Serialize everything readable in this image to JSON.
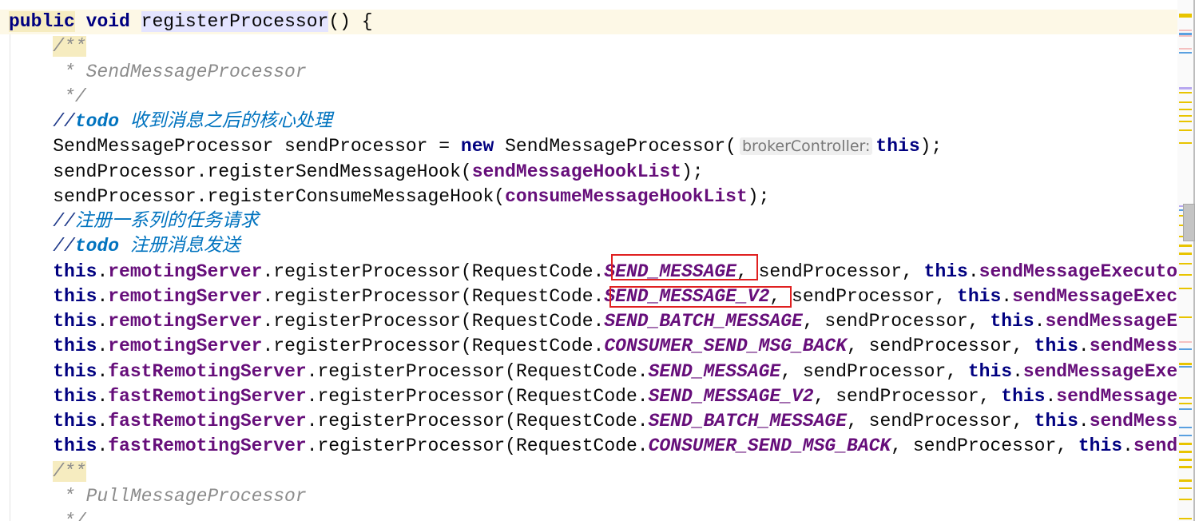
{
  "editor": {
    "lines": [
      [
        {
          "t": "public",
          "c": "kw hl-match"
        },
        {
          "t": " "
        },
        {
          "t": "void",
          "c": "kw"
        },
        {
          "t": " "
        },
        {
          "t": "registerProcessor",
          "c": "hl-ident"
        },
        {
          "t": "() {"
        }
      ],
      [
        {
          "t": "    "
        },
        {
          "t": "/**",
          "c": "doc hl-match"
        }
      ],
      [
        {
          "t": "     * SendMessageProcessor",
          "c": "doc"
        }
      ],
      [
        {
          "t": "     */",
          "c": "doc"
        }
      ],
      [
        {
          "t": "    "
        },
        {
          "t": "//",
          "c": "cmslash"
        },
        {
          "t": "todo",
          "c": "todo"
        },
        {
          "t": " 收到消息之后的核心处理",
          "c": "cm"
        }
      ],
      [
        {
          "t": "    SendMessageProcessor sendProcessor = "
        },
        {
          "t": "new",
          "c": "kw"
        },
        {
          "t": " SendMessageProcessor("
        },
        {
          "t": "brokerController:",
          "c": "hint"
        },
        {
          "t": "this",
          "c": "kw"
        },
        {
          "t": ");"
        }
      ],
      [
        {
          "t": "    sendProcessor.registerSendMessageHook("
        },
        {
          "t": "sendMessageHookList",
          "c": "fld"
        },
        {
          "t": ");"
        }
      ],
      [
        {
          "t": "    sendProcessor.registerConsumeMessageHook("
        },
        {
          "t": "consumeMessageHookList",
          "c": "fld"
        },
        {
          "t": ");"
        }
      ],
      [
        {
          "t": "    "
        },
        {
          "t": "//",
          "c": "cmslash"
        },
        {
          "t": "注册一系列的任务请求",
          "c": "cm"
        }
      ],
      [
        {
          "t": "    "
        },
        {
          "t": "//",
          "c": "cmslash"
        },
        {
          "t": "todo",
          "c": "todo"
        },
        {
          "t": " 注册消息发送",
          "c": "cm"
        }
      ],
      [
        {
          "t": "    "
        },
        {
          "t": "this",
          "c": "kw"
        },
        {
          "t": "."
        },
        {
          "t": "remotingServer",
          "c": "fld"
        },
        {
          "t": ".registerProcessor(RequestCode."
        },
        {
          "t": "SEND_MESSAGE",
          "c": "cst"
        },
        {
          "t": ", sendProcessor, "
        },
        {
          "t": "this",
          "c": "kw"
        },
        {
          "t": "."
        },
        {
          "t": "sendMessageExecuto",
          "c": "fld"
        }
      ],
      [
        {
          "t": "    "
        },
        {
          "t": "this",
          "c": "kw"
        },
        {
          "t": "."
        },
        {
          "t": "remotingServer",
          "c": "fld"
        },
        {
          "t": ".registerProcessor(RequestCode."
        },
        {
          "t": "SEND_MESSAGE_V2",
          "c": "cst"
        },
        {
          "t": ", sendProcessor, "
        },
        {
          "t": "this",
          "c": "kw"
        },
        {
          "t": "."
        },
        {
          "t": "sendMessageExec",
          "c": "fld"
        }
      ],
      [
        {
          "t": "    "
        },
        {
          "t": "this",
          "c": "kw"
        },
        {
          "t": "."
        },
        {
          "t": "remotingServer",
          "c": "fld"
        },
        {
          "t": ".registerProcessor(RequestCode."
        },
        {
          "t": "SEND_BATCH_MESSAGE",
          "c": "cst"
        },
        {
          "t": ", sendProcessor, "
        },
        {
          "t": "this",
          "c": "kw"
        },
        {
          "t": "."
        },
        {
          "t": "sendMessageE",
          "c": "fld"
        }
      ],
      [
        {
          "t": "    "
        },
        {
          "t": "this",
          "c": "kw"
        },
        {
          "t": "."
        },
        {
          "t": "remotingServer",
          "c": "fld"
        },
        {
          "t": ".registerProcessor(RequestCode."
        },
        {
          "t": "CONSUMER_SEND_MSG_BACK",
          "c": "cst"
        },
        {
          "t": ", sendProcessor, "
        },
        {
          "t": "this",
          "c": "kw"
        },
        {
          "t": "."
        },
        {
          "t": "sendMess",
          "c": "fld"
        }
      ],
      [
        {
          "t": "    "
        },
        {
          "t": "this",
          "c": "kw"
        },
        {
          "t": "."
        },
        {
          "t": "fastRemotingServer",
          "c": "fld"
        },
        {
          "t": ".registerProcessor(RequestCode."
        },
        {
          "t": "SEND_MESSAGE",
          "c": "cst"
        },
        {
          "t": ", sendProcessor, "
        },
        {
          "t": "this",
          "c": "kw"
        },
        {
          "t": "."
        },
        {
          "t": "sendMessageExe",
          "c": "fld"
        }
      ],
      [
        {
          "t": "    "
        },
        {
          "t": "this",
          "c": "kw"
        },
        {
          "t": "."
        },
        {
          "t": "fastRemotingServer",
          "c": "fld"
        },
        {
          "t": ".registerProcessor(RequestCode."
        },
        {
          "t": "SEND_MESSAGE_V2",
          "c": "cst"
        },
        {
          "t": ", sendProcessor, "
        },
        {
          "t": "this",
          "c": "kw"
        },
        {
          "t": "."
        },
        {
          "t": "sendMessage",
          "c": "fld"
        }
      ],
      [
        {
          "t": "    "
        },
        {
          "t": "this",
          "c": "kw"
        },
        {
          "t": "."
        },
        {
          "t": "fastRemotingServer",
          "c": "fld"
        },
        {
          "t": ".registerProcessor(RequestCode."
        },
        {
          "t": "SEND_BATCH_MESSAGE",
          "c": "cst"
        },
        {
          "t": ", sendProcessor, "
        },
        {
          "t": "this",
          "c": "kw"
        },
        {
          "t": "."
        },
        {
          "t": "sendMess",
          "c": "fld"
        }
      ],
      [
        {
          "t": "    "
        },
        {
          "t": "this",
          "c": "kw"
        },
        {
          "t": "."
        },
        {
          "t": "fastRemotingServer",
          "c": "fld"
        },
        {
          "t": ".registerProcessor(RequestCode."
        },
        {
          "t": "CONSUMER_SEND_MSG_BACK",
          "c": "cst"
        },
        {
          "t": ", sendProcessor, "
        },
        {
          "t": "this",
          "c": "kw"
        },
        {
          "t": "."
        },
        {
          "t": "send",
          "c": "fld"
        }
      ],
      [
        {
          "t": "    "
        },
        {
          "t": "/**",
          "c": "doc hl-match"
        }
      ],
      [
        {
          "t": "     * PullMessageProcessor",
          "c": "doc"
        }
      ],
      [
        {
          "t": "     */",
          "c": "doc"
        }
      ]
    ]
  },
  "colors": {
    "keyword": "#000080",
    "field": "#660e7a",
    "comment": "#8c8c8c",
    "todo": "#0073bf",
    "annotation_box": "#e02020"
  }
}
